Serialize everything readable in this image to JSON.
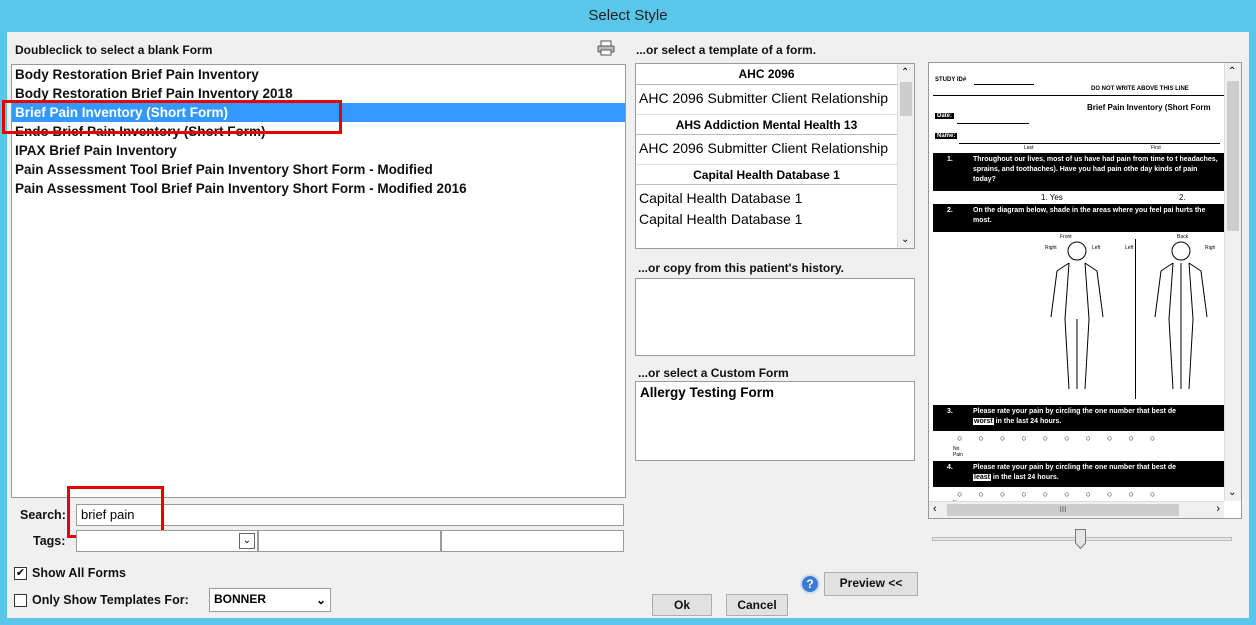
{
  "window": {
    "title": "Select Style"
  },
  "left": {
    "header": "Doubleclick to select a blank Form",
    "print_icon": "printer-icon",
    "forms": [
      "Body Restoration Brief Pain Inventory",
      "Body Restoration Brief Pain Inventory 2018",
      "Brief Pain Inventory (Short Form)",
      "Endo Brief Pain Inventory (Short Form)",
      "IPAX Brief Pain Inventory",
      "Pain Assessment Tool Brief Pain Inventory Short Form - Modified",
      "Pain Assessment Tool Brief Pain Inventory Short Form - Modified 2016"
    ],
    "selected_index": 2,
    "search_label": "Search:",
    "search_value": "brief pain",
    "tags_label": "Tags:",
    "show_all_forms_label": "Show All Forms",
    "show_all_forms_checked": true,
    "only_templates_label": "Only Show Templates For:",
    "only_templates_checked": false,
    "templates_for_value": "BONNER"
  },
  "middle": {
    "template_header": "...or select a template of a form.",
    "template_groups": [
      {
        "heading": "AHC 2096",
        "items": [
          "AHC 2096 Submitter Client Relationship"
        ]
      },
      {
        "heading": "AHS Addiction Mental Health 13",
        "items": [
          "AHC 2096 Submitter Client Relationship"
        ]
      },
      {
        "heading": "Capital Health Database 1",
        "items": [
          "Capital Health Database 1",
          "Capital Health Database 1"
        ]
      }
    ],
    "history_header": "...or copy from this patient's history.",
    "custom_header": "...or select a Custom Form",
    "custom_forms": [
      "Allergy Testing Form"
    ],
    "preview_button": "Preview <<",
    "ok_button": "Ok",
    "cancel_button": "Cancel"
  },
  "preview": {
    "study_id": "STUDY ID#",
    "do_not_write": "DO NOT WRITE ABOVE THIS LINE",
    "form_title": "Brief Pain Inventory (Short Form",
    "date_label": "Date:",
    "name_label": "Name:",
    "last_label": "Last",
    "first_label": "First",
    "q1_num": "1.",
    "q1_text": "Throughout our lives, most of us have had pain from time to t headaches, sprains, and toothaches). Have you had pain othe day kinds of pain today?",
    "q1_yes": "1.  Yes",
    "q1_no": "2.",
    "q2_num": "2.",
    "q2_text": "On the diagram below, shade in the areas where you feel pai hurts the most.",
    "front": "Front",
    "back": "Back",
    "right": "Right",
    "left": "Left",
    "left2": "Left",
    "right2": "Righ",
    "q3_num": "3.",
    "q3_text": "Please rate your pain by circling the one number that best de",
    "q3_worst": "worst",
    "q3_rest": "in the last 24 hours.",
    "no_pain": "No Pain",
    "q4_num": "4.",
    "q4_text": "Please rate your pain by circling the one number that best de",
    "q4_least": "least",
    "q4_rest": "in the last 24 hours.",
    "no2": "No"
  }
}
